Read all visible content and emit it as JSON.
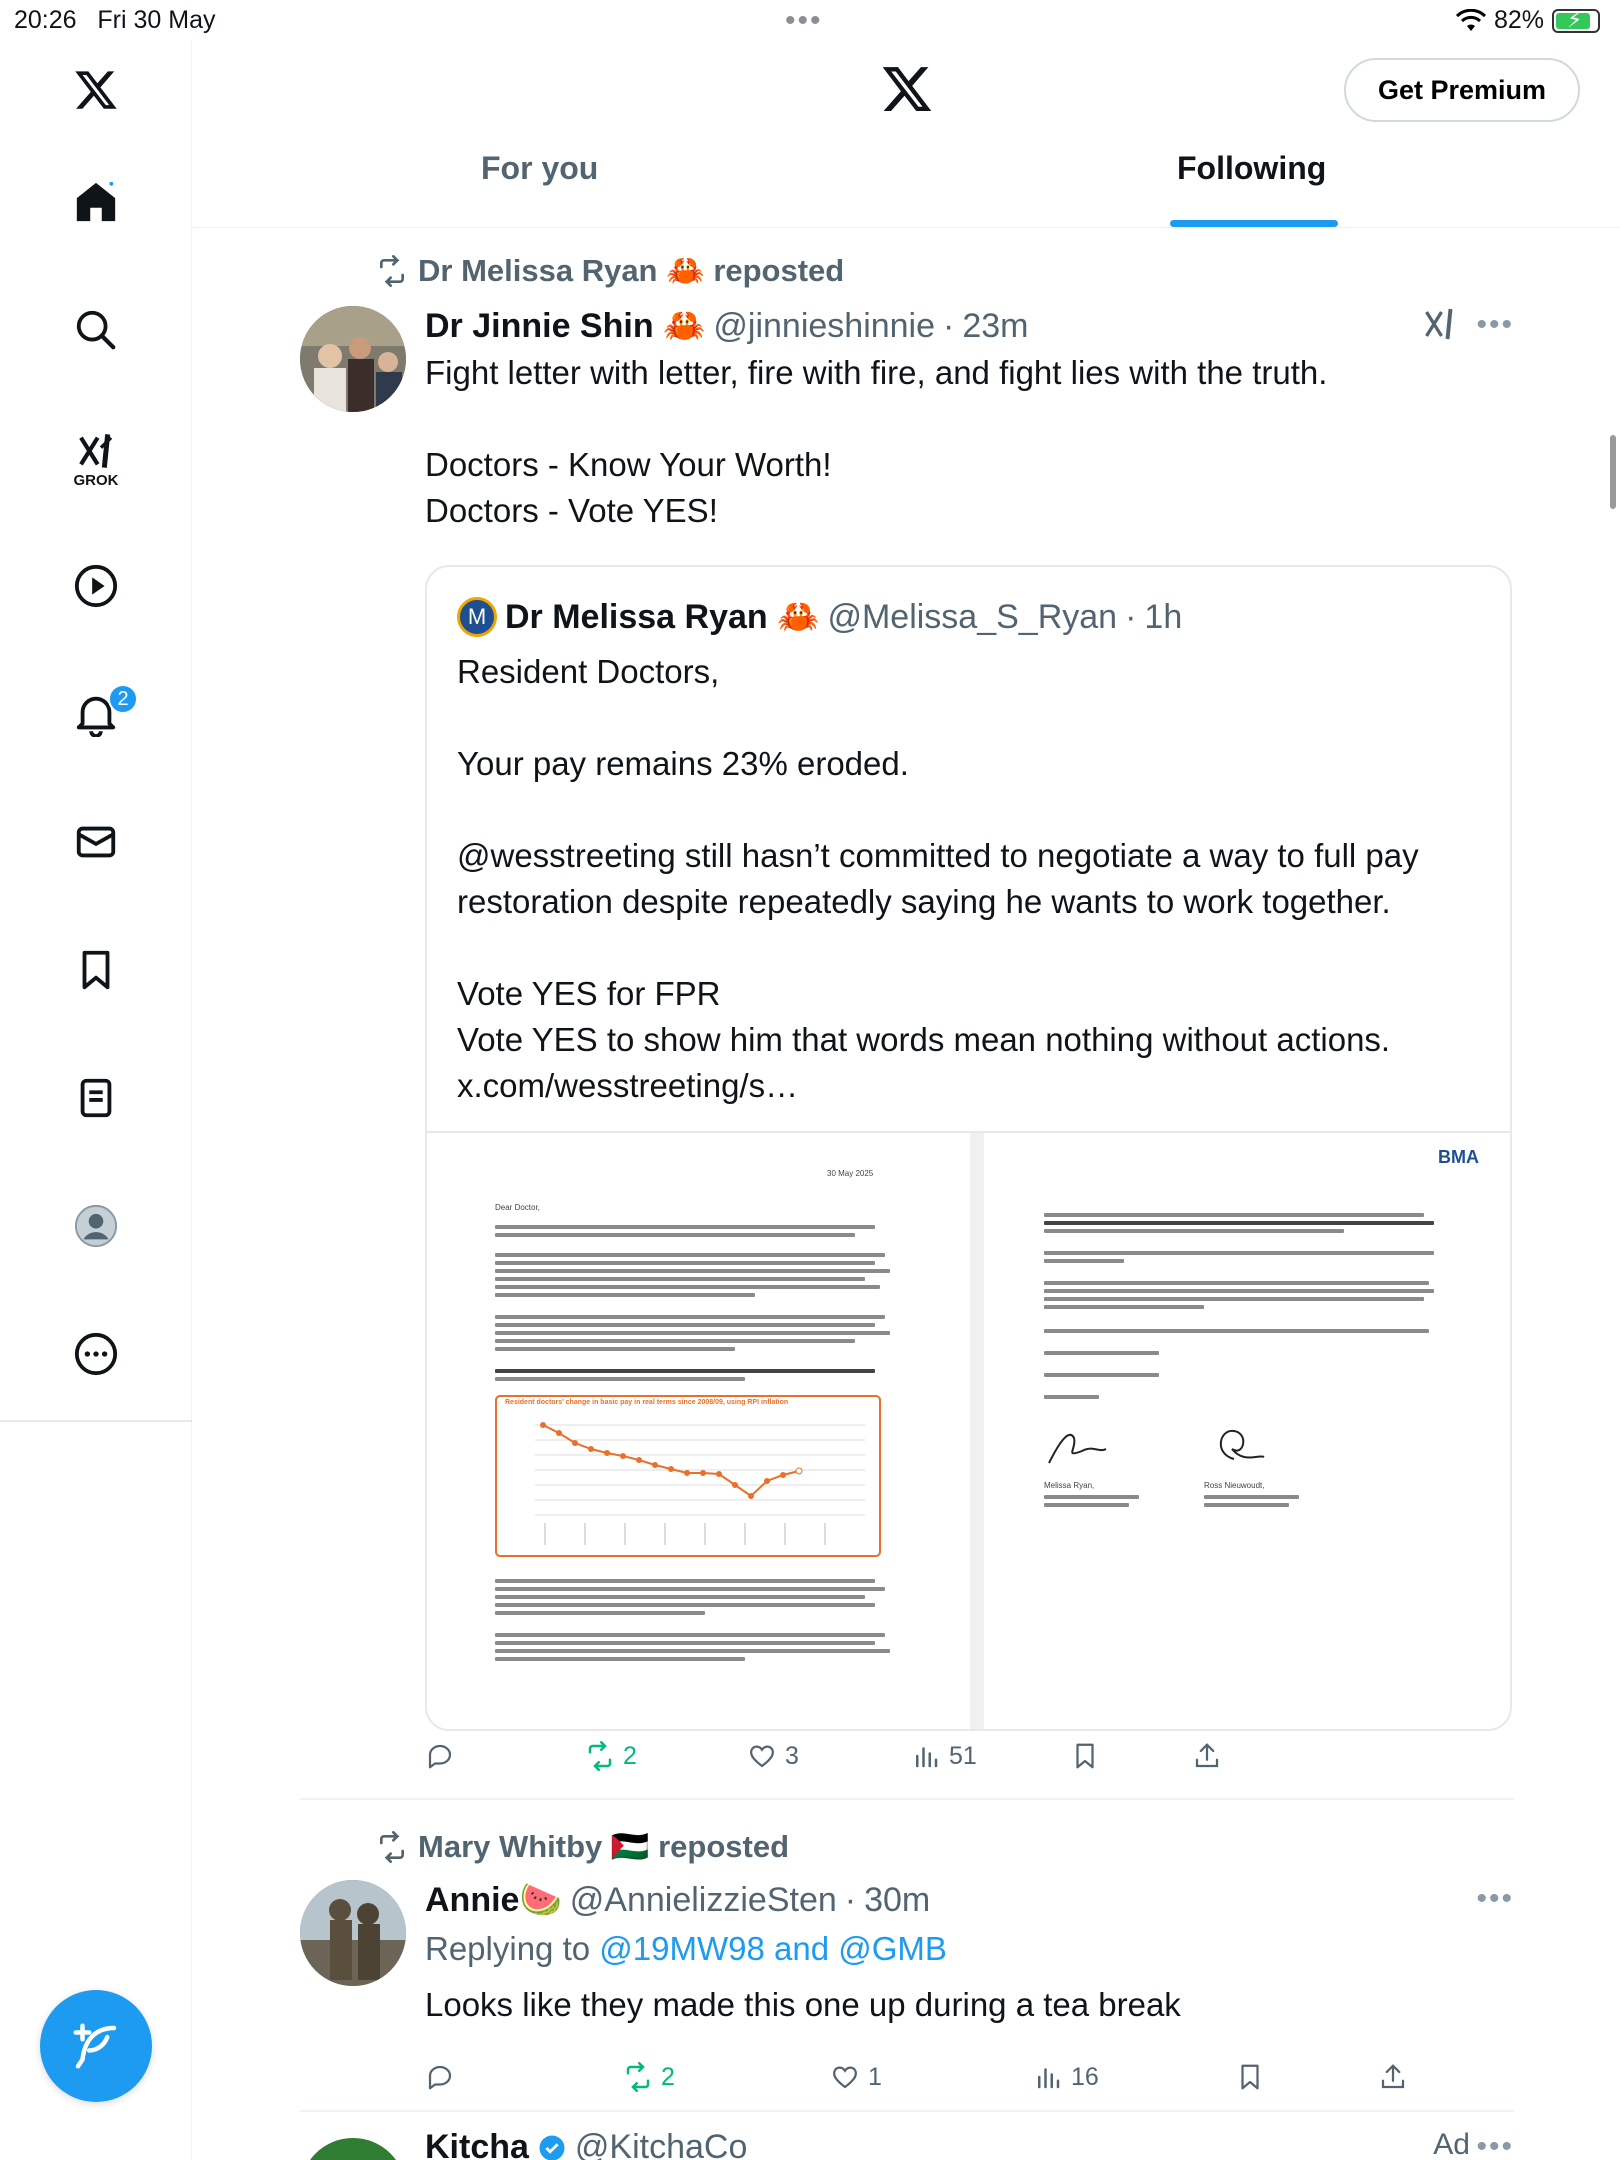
{
  "status_bar": {
    "time": "20:26",
    "date": "Fri 30 May",
    "battery": "82%"
  },
  "header": {
    "premium_label": "Get Premium",
    "tabs": [
      {
        "label": "For you"
      },
      {
        "label": "Following"
      }
    ]
  },
  "sidebar": {
    "grok_label": "GROK",
    "notifications_badge": "2"
  },
  "colors": {
    "accent": "#1d9bf0",
    "repost_green": "#00ba7c",
    "text_secondary": "#536471"
  },
  "posts": [
    {
      "repost_by": "Dr Melissa Ryan 🦀 reposted",
      "name": "Dr Jinnie Shin 🦀",
      "handle": "@jinnieshinnie",
      "time": "23m",
      "text": "Fight letter with letter, fire with fire, and fight lies with the truth.\n\nDoctors - Know Your Worth!\nDoctors - Vote YES!",
      "quote": {
        "avatar_letter": "M",
        "name": "Dr Melissa Ryan 🦀",
        "handle": "@Melissa_S_Ryan",
        "time": "1h",
        "text": "Resident Doctors,\n\nYour pay remains 23% eroded.\n\n@wesstreeting still hasn’t committed to negotiate a way to full pay restoration despite repeatedly saying he wants to work together.\n\nVote YES for FPR\nVote YES to show him that words mean nothing without actions.\nx.com/wesstreeting/s…",
        "doc_date": "30 May 2025",
        "doc_salutation": "Dear Doctor,",
        "doc_chart_title": "Resident doctors’ change in basic pay in real terms since 2008/09, using RPI inflation",
        "doc_brand": "BMA",
        "sign1": "Melissa Ryan,",
        "sign2": "Ross Nieuwoudt,"
      },
      "stats": {
        "replies": "",
        "reposts": "2",
        "likes": "3",
        "views": "51"
      }
    },
    {
      "repost_by": "Mary Whitby 🇵🇸 reposted",
      "name": "Annie🍉",
      "handle": "@AnnielizzieSten",
      "time": "30m",
      "replying_prefix": "Replying to",
      "replying_to": "@19MW98 and @GMB",
      "text": "Looks like they made this one up during a tea break",
      "stats": {
        "replies": "",
        "reposts": "2",
        "likes": "1",
        "views": "16"
      }
    },
    {
      "name": "Kitcha",
      "handle": "@KitchaCo",
      "ad_label": "Ad"
    }
  ]
}
